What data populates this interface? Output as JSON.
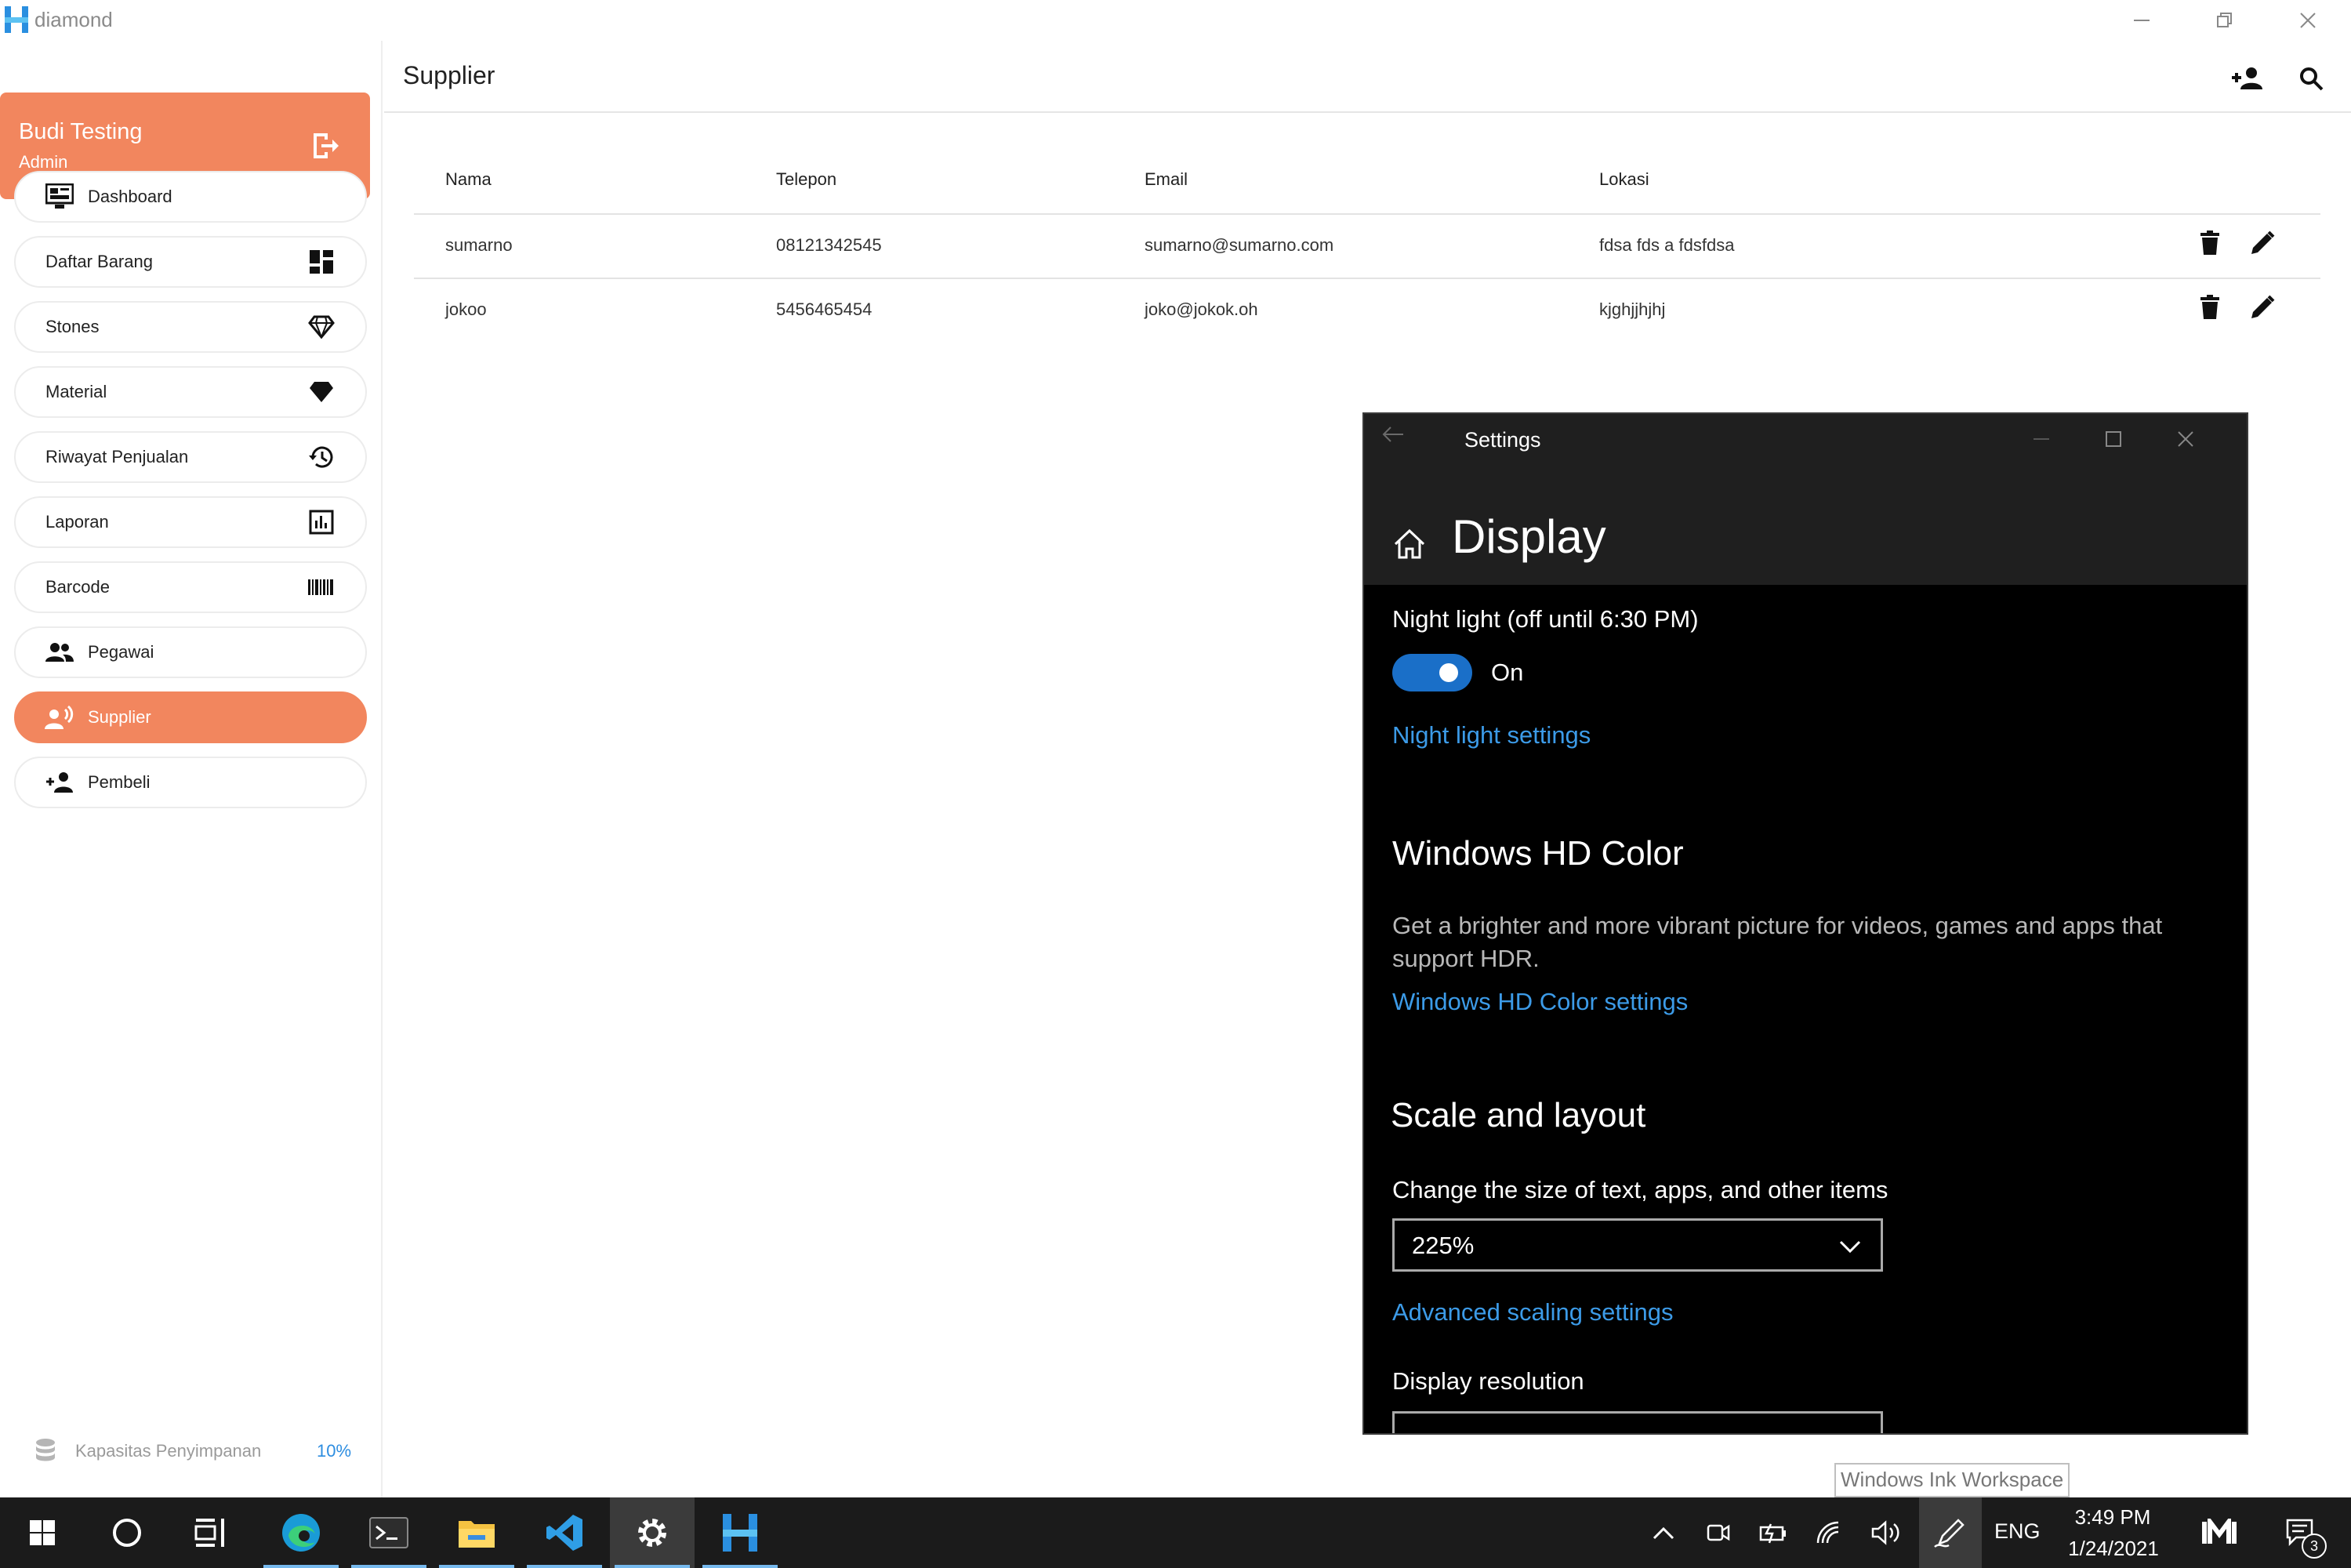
{
  "app": {
    "name": "diamond"
  },
  "sidebar": {
    "user": {
      "name": "Budi Testing",
      "role": "Admin"
    },
    "items": [
      {
        "label": "Dashboard",
        "icon": "monitor-dashboard-icon"
      },
      {
        "label": "Daftar Barang",
        "icon": "grid-dashboard-icon"
      },
      {
        "label": "Stones",
        "icon": "diamond-outline-icon"
      },
      {
        "label": "Material",
        "icon": "diamond-filled-icon"
      },
      {
        "label": "Riwayat Penjualan",
        "icon": "history-icon"
      },
      {
        "label": "Laporan",
        "icon": "chart-box-icon"
      },
      {
        "label": "Barcode",
        "icon": "barcode-icon"
      },
      {
        "label": "Pegawai",
        "icon": "people-icon"
      },
      {
        "label": "Supplier",
        "icon": "supplier-icon",
        "active": true
      },
      {
        "label": "Pembeli",
        "icon": "add-person-icon"
      }
    ],
    "storage": {
      "label": "Kapasitas Penyimpanan",
      "value": "10%"
    }
  },
  "page": {
    "title": "Supplier"
  },
  "table": {
    "columns": [
      "Nama",
      "Telepon",
      "Email",
      "Lokasi"
    ],
    "rows": [
      {
        "nama": "sumarno",
        "telepon": "08121342545",
        "email": "sumarno@sumarno.com",
        "lokasi": "fdsa fds a fdsfdsa"
      },
      {
        "nama": "jokoo",
        "telepon": "5456465454",
        "email": "joko@jokok.oh",
        "lokasi": "kjghjjhjhj"
      }
    ]
  },
  "settings": {
    "window_title": "Settings",
    "page_title": "Display",
    "night_light_label": "Night light (off until 6:30 PM)",
    "toggle_state": "On",
    "night_light_link": "Night light settings",
    "hdr_heading": "Windows HD Color",
    "hdr_description": "Get a brighter and more vibrant picture for videos, games and apps that support HDR.",
    "hdr_link": "Windows HD Color settings",
    "scale_heading": "Scale and layout",
    "scale_label": "Change the size of text, apps, and other items",
    "scale_value": "225%",
    "advanced_link": "Advanced scaling settings",
    "resolution_label": "Display resolution"
  },
  "tooltip": {
    "text": "Windows Ink Workspace"
  },
  "taskbar": {
    "language": "ENG",
    "time": "3:49 PM",
    "date": "1/24/2021",
    "notification_count": "3"
  },
  "colors": {
    "accent": "#f2865e",
    "link": "#3c9be8",
    "toggle": "#1a6fc8"
  }
}
